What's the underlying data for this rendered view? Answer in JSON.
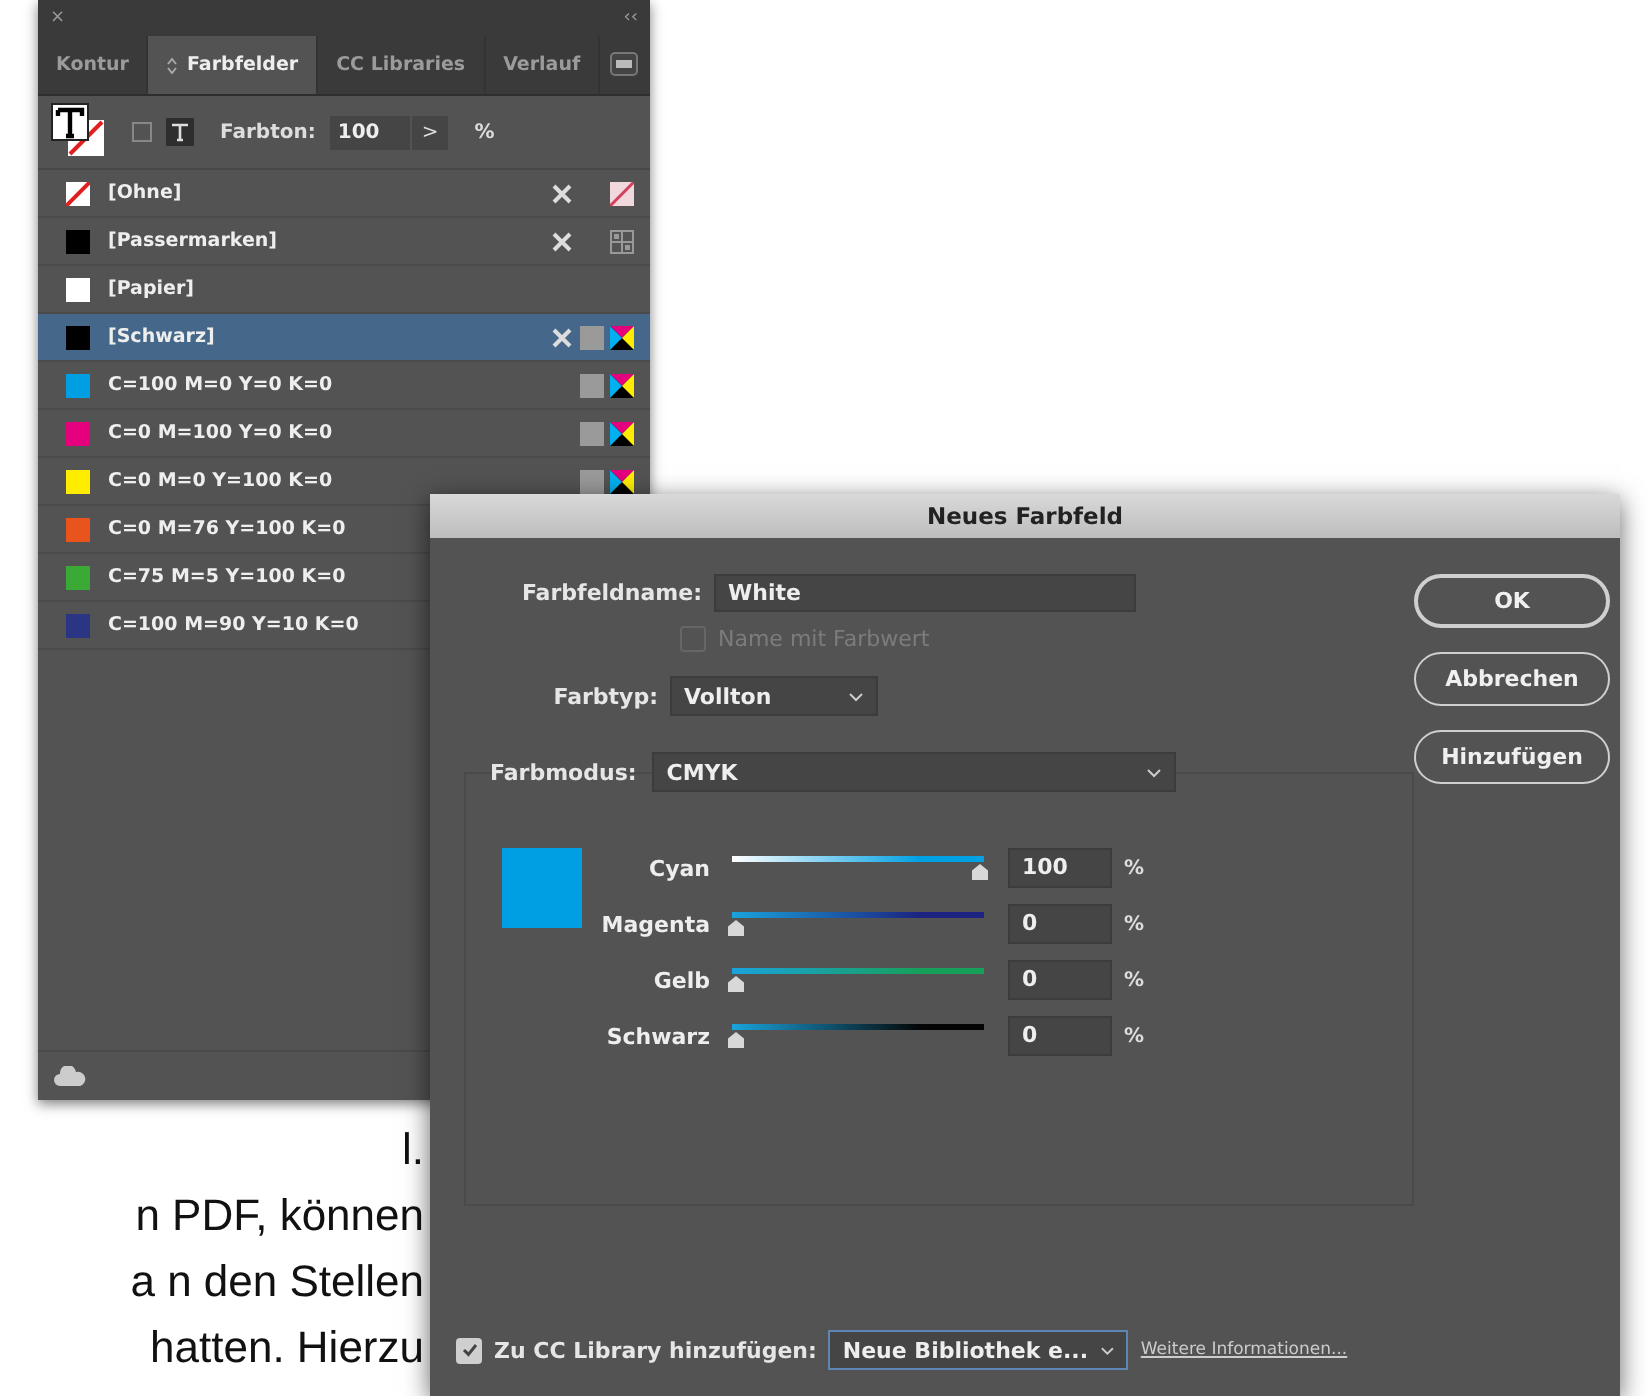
{
  "panel": {
    "close_glyph": "×",
    "collapse_glyph": "‹‹",
    "tabs": [
      {
        "label": "Kontur",
        "selected": false
      },
      {
        "label": "Farbfelder",
        "selected": true
      },
      {
        "label": "CC Libraries",
        "selected": false
      },
      {
        "label": "Verlauf",
        "selected": false
      }
    ],
    "tint": {
      "label": "Farbton:",
      "value": "100",
      "step_glyph": ">",
      "unit": "%"
    },
    "swatches": [
      {
        "name": "[Ohne]",
        "kind": "none",
        "selected": false,
        "noneditable": true,
        "process": false
      },
      {
        "name": "[Passermarken]",
        "kind": "registration",
        "color": "#000000",
        "selected": false,
        "noneditable": true,
        "process": false
      },
      {
        "name": "[Papier]",
        "kind": "paper",
        "color": "#ffffff",
        "selected": false,
        "noneditable": false,
        "process": false
      },
      {
        "name": "[Schwarz]",
        "kind": "cmyk",
        "color": "#000000",
        "selected": true,
        "noneditable": true,
        "process": true
      },
      {
        "name": "C=100 M=0 Y=0 K=0",
        "kind": "cmyk",
        "color": "#009fe3",
        "selected": false,
        "noneditable": false,
        "process": true
      },
      {
        "name": "C=0 M=100 Y=0 K=0",
        "kind": "cmyk",
        "color": "#e5007d",
        "selected": false,
        "noneditable": false,
        "process": true
      },
      {
        "name": "C=0 M=0 Y=100 K=0",
        "kind": "cmyk",
        "color": "#ffed00",
        "selected": false,
        "noneditable": false,
        "process": true
      },
      {
        "name": "C=0 M=76 Y=100 K=0",
        "kind": "color",
        "color": "#e9541d",
        "selected": false
      },
      {
        "name": "C=75 M=5 Y=100 K=0",
        "kind": "color",
        "color": "#3aa935",
        "selected": false
      },
      {
        "name": "C=100 M=90 Y=10 K=0",
        "kind": "color",
        "color": "#2a3583",
        "selected": false
      }
    ]
  },
  "dialog": {
    "title": "Neues Farbfeld",
    "name_label": "Farbfeldname:",
    "name_value": "White",
    "name_with_value": {
      "label": "Name mit Farbwert",
      "checked": false,
      "disabled": true
    },
    "type_label": "Farbtyp:",
    "type_value": "Vollton",
    "mode_label": "Farbmodus:",
    "mode_value": "CMYK",
    "preview": {
      "color": "#009fe3"
    },
    "sliders": [
      {
        "label": "Cyan",
        "level": 1,
        "value": "100",
        "unit": "%",
        "color": "#00a0e3"
      },
      {
        "label": "Magenta",
        "level": 0,
        "value": "0",
        "unit": "%",
        "color": "#1c2380"
      },
      {
        "label": "Gelb",
        "level": 0,
        "value": "0",
        "unit": "%",
        "color": "#17a05a"
      },
      {
        "label": "Schwarz",
        "level": 0,
        "value": "0",
        "unit": "%",
        "color": "#050505"
      }
    ],
    "buttons": [
      "OK",
      "Abbrechen",
      "Hinzufügen"
    ],
    "library": {
      "label": "Zu CC Library hinzufügen:",
      "checked": true,
      "value": "Neue Bibliothek e...",
      "link": "Weitere Informationen..."
    }
  },
  "document_lines": [
    "l.",
    "n PDF, können",
    "a n den Stellen",
    "hatten. Hierzu"
  ]
}
